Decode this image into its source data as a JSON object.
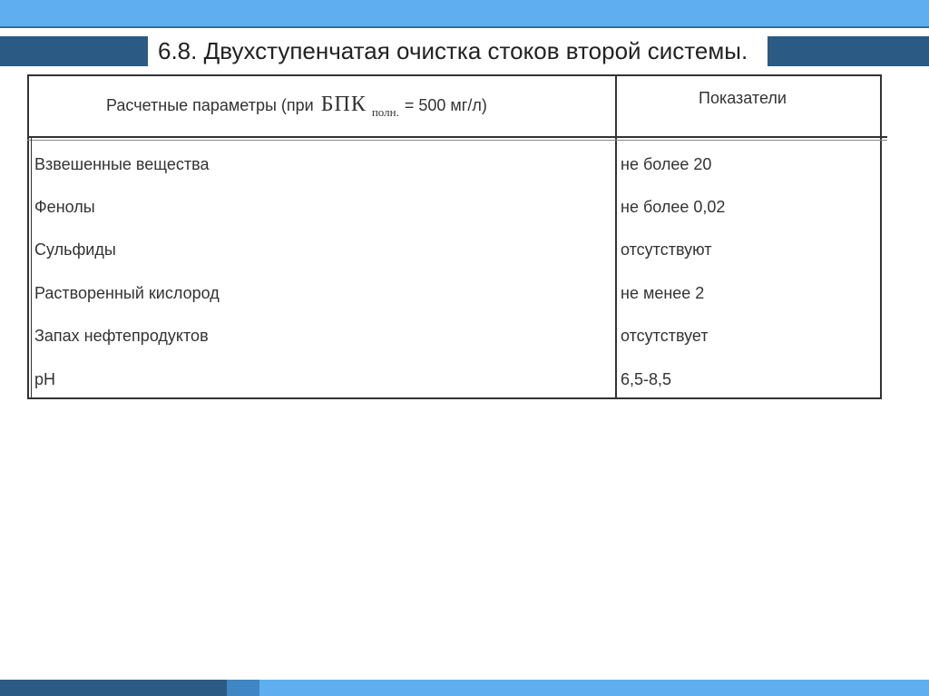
{
  "slide": {
    "title": "6.8. Двухступенчатая очистка стоков второй системы."
  },
  "table": {
    "header": {
      "params_prefix": "Расчетные параметры (при",
      "bpk": "БПК",
      "bpk_sub": "полн.",
      "params_suffix": "= 500 мг/л)",
      "indicators": "Показатели"
    },
    "rows": [
      {
        "param": "Взвешенные вещества",
        "value": "не более 20"
      },
      {
        "param": "Фенолы",
        "value": "не более 0,02"
      },
      {
        "param": "Сульфиды",
        "value": "отсутствуют"
      },
      {
        "param": "Растворенный кислород",
        "value": "не менее 2"
      },
      {
        "param": "Запах нефтепродуктов",
        "value": "отсутствует"
      },
      {
        "param": "pH",
        "value": "6,5-8,5"
      }
    ]
  },
  "colors": {
    "band_light": "#5faff0",
    "band_dark": "#2b5a84",
    "band_mid": "#3f86c4"
  }
}
